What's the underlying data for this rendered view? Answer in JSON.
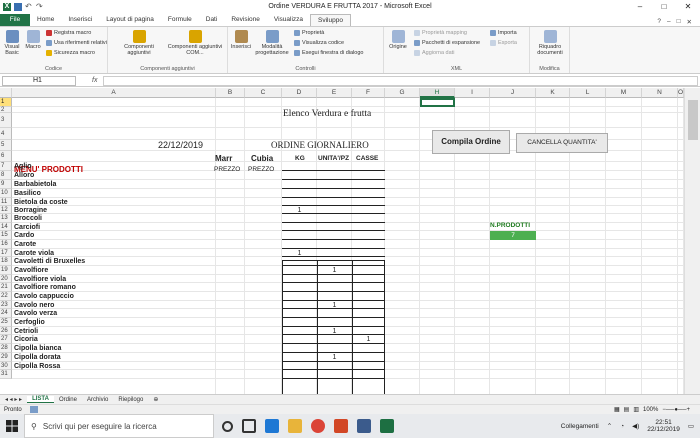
{
  "window": {
    "title": "Ordine VERDURA E FRUTTA 2017 - Microsoft Excel",
    "controls": [
      "–",
      "□",
      "✕"
    ]
  },
  "tabs": [
    "File",
    "Home",
    "Inserisci",
    "Layout di pagina",
    "Formule",
    "Dati",
    "Revisione",
    "Visualizza",
    "Sviluppo"
  ],
  "active_tab": "Sviluppo",
  "ribbon": {
    "codice": {
      "label": "Codice",
      "visual_basic": "Visual Basic",
      "macro": "Macro",
      "registra": "Registra macro",
      "riferimenti": "Usa riferimenti relativi",
      "sicurezza": "Sicurezza macro"
    },
    "componenti": {
      "label": "Componenti aggiuntivi",
      "comp1": "Componenti aggiuntivi",
      "comp2": "Componenti aggiuntivi COM..."
    },
    "controlli": {
      "label": "Controlli",
      "inserisci": "Inserisci",
      "modalita": "Modalità progettazione",
      "proprieta": "Proprietà",
      "visualizza": "Visualizza codice",
      "esegui": "Esegui finestra di dialogo"
    },
    "xml": {
      "label": "XML",
      "origine": "Origine",
      "proprieta_mapping": "Proprietà mapping",
      "pacchetti": "Pacchetti di espansione",
      "aggiorna": "Aggiorna dati",
      "importa": "Importa",
      "esporta": "Esporta"
    },
    "modifica": {
      "label": "Modifica",
      "riquadro": "Riquadro documenti"
    }
  },
  "formula_bar": {
    "name_box": "H1",
    "fx": "fx",
    "value": ""
  },
  "columns": [
    "A",
    "B",
    "C",
    "D",
    "E",
    "F",
    "G",
    "H",
    "I",
    "J",
    "K",
    "L",
    "M",
    "N",
    "O"
  ],
  "selected_column": "H",
  "selected_row": "1",
  "sheet": {
    "title": "Elenco Verdura e frutta",
    "date": "22/12/2019",
    "order_title": "ORDINE GIORNALIERO",
    "marr": "Marr",
    "cubia": "Cubia",
    "kg": "KG",
    "unita": "UNITA'/PZ",
    "casse": "CASSE",
    "menu": "MENU' PRODOTTI",
    "prezzo1": "PREZZO",
    "prezzo2": "PREZZO",
    "btn_compila": "Compila Ordine",
    "btn_cancella": "CANCELLA QUANTITA'",
    "n_prodotti_label": "N.PRODOTTI",
    "n_prodotti_value": "7"
  },
  "products": [
    "Aglio",
    "Alloro",
    "Barbabietola",
    "Basilico",
    "Bietola da coste",
    "Borragine",
    "Broccoli",
    "Carciofi",
    "Cardo",
    "Carote",
    "Carote viola",
    "Cavoletti di Bruxelles",
    "Cavolfiore",
    "Cavolfiore viola",
    "Cavolfiore romano",
    "Cavolo cappuccio",
    "Cavolo nero",
    "Cavolo verza",
    "Cerfoglio",
    "Cetrioli",
    "Cicoria",
    "Cipolla bianca",
    "Cipolla dorata",
    "Cipolla Rossa"
  ],
  "quantities": [
    {
      "row": "12",
      "col": "D",
      "value": "1"
    },
    {
      "row": "17",
      "col": "D",
      "value": "1"
    },
    {
      "row": "19",
      "col": "E",
      "value": "1"
    },
    {
      "row": "23",
      "col": "E",
      "value": "1"
    },
    {
      "row": "26",
      "col": "E",
      "value": "1"
    },
    {
      "row": "27",
      "col": "F",
      "value": "1"
    },
    {
      "row": "29",
      "col": "E",
      "value": "1"
    }
  ],
  "sheet_tabs": [
    "LISTA",
    "Ordine",
    "Archivio",
    "Riepilogo"
  ],
  "active_sheet": "LISTA",
  "status": {
    "mode": "Pronto",
    "zoom": "100%"
  },
  "taskbar": {
    "search_placeholder": "Scrivi qui per eseguire la ricerca",
    "network": "Collegamenti",
    "time": "22:51",
    "date": "22/12/2019"
  },
  "colors": {
    "excel_green": "#217346",
    "menu_red": "#c00000",
    "nprod_green": "#4caf50",
    "nprod_label_green": "#1e7b1e",
    "selected_row": "#ffe07a"
  }
}
